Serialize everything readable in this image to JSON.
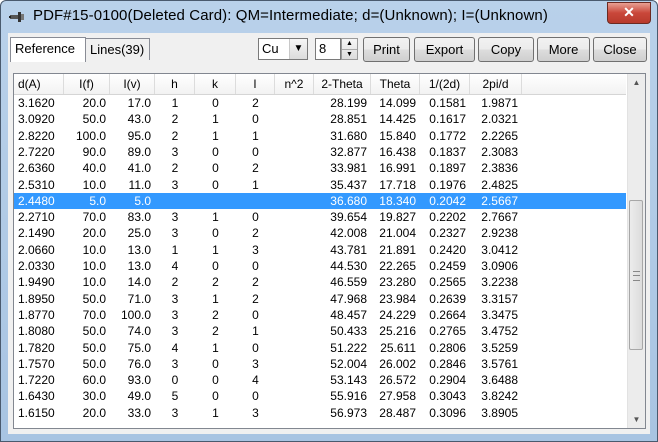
{
  "window": {
    "title": "PDF#15-0100(Deleted Card): QM=Intermediate; d=(Unknown); I=(Unknown)",
    "close_label": "✕"
  },
  "tabs": [
    {
      "label": "Reference"
    },
    {
      "label": "Lines(39)"
    }
  ],
  "controls": {
    "wavelength": "Cu",
    "decimals": "8",
    "print_label": "Print",
    "export_label": "Export",
    "copy_label": "Copy",
    "more_label": "More",
    "close_label": "Close"
  },
  "table": {
    "columns": [
      "d(A)",
      "I(f)",
      "I(v)",
      "h",
      "k",
      "l",
      "n^2",
      "2-Theta",
      "Theta",
      "1/(2d)",
      "2pi/d"
    ],
    "rows": [
      [
        "3.1620",
        "20.0",
        "17.0",
        "1",
        "0",
        "2",
        "",
        "28.199",
        "14.099",
        "0.1581",
        "1.9871"
      ],
      [
        "3.0920",
        "50.0",
        "43.0",
        "2",
        "1",
        "0",
        "",
        "28.851",
        "14.425",
        "0.1617",
        "2.0321"
      ],
      [
        "2.8220",
        "100.0",
        "95.0",
        "2",
        "1",
        "1",
        "",
        "31.680",
        "15.840",
        "0.1772",
        "2.2265"
      ],
      [
        "2.7220",
        "90.0",
        "89.0",
        "3",
        "0",
        "0",
        "",
        "32.877",
        "16.438",
        "0.1837",
        "2.3083"
      ],
      [
        "2.6360",
        "40.0",
        "41.0",
        "2",
        "0",
        "2",
        "",
        "33.981",
        "16.991",
        "0.1897",
        "2.3836"
      ],
      [
        "2.5310",
        "10.0",
        "11.0",
        "3",
        "0",
        "1",
        "",
        "35.437",
        "17.718",
        "0.1976",
        "2.4825"
      ],
      [
        "2.4480",
        "5.0",
        "5.0",
        "",
        "",
        "",
        "",
        "36.680",
        "18.340",
        "0.2042",
        "2.5667"
      ],
      [
        "2.2710",
        "70.0",
        "83.0",
        "3",
        "1",
        "0",
        "",
        "39.654",
        "19.827",
        "0.2202",
        "2.7667"
      ],
      [
        "2.1490",
        "20.0",
        "25.0",
        "3",
        "0",
        "2",
        "",
        "42.008",
        "21.004",
        "0.2327",
        "2.9238"
      ],
      [
        "2.0660",
        "10.0",
        "13.0",
        "1",
        "1",
        "3",
        "",
        "43.781",
        "21.891",
        "0.2420",
        "3.0412"
      ],
      [
        "2.0330",
        "10.0",
        "13.0",
        "4",
        "0",
        "0",
        "",
        "44.530",
        "22.265",
        "0.2459",
        "3.0906"
      ],
      [
        "1.9490",
        "10.0",
        "14.0",
        "2",
        "2",
        "2",
        "",
        "46.559",
        "23.280",
        "0.2565",
        "3.2238"
      ],
      [
        "1.8950",
        "50.0",
        "71.0",
        "3",
        "1",
        "2",
        "",
        "47.968",
        "23.984",
        "0.2639",
        "3.3157"
      ],
      [
        "1.8770",
        "70.0",
        "100.0",
        "3",
        "2",
        "0",
        "",
        "48.457",
        "24.229",
        "0.2664",
        "3.3475"
      ],
      [
        "1.8080",
        "50.0",
        "74.0",
        "3",
        "2",
        "1",
        "",
        "50.433",
        "25.216",
        "0.2765",
        "3.4752"
      ],
      [
        "1.7820",
        "50.0",
        "75.0",
        "4",
        "1",
        "0",
        "",
        "51.222",
        "25.611",
        "0.2806",
        "3.5259"
      ],
      [
        "1.7570",
        "50.0",
        "76.0",
        "3",
        "0",
        "3",
        "",
        "52.004",
        "26.002",
        "0.2846",
        "3.5761"
      ],
      [
        "1.7220",
        "60.0",
        "93.0",
        "0",
        "0",
        "4",
        "",
        "53.143",
        "26.572",
        "0.2904",
        "3.6488"
      ],
      [
        "1.6430",
        "30.0",
        "49.0",
        "5",
        "0",
        "0",
        "",
        "55.916",
        "27.958",
        "0.3043",
        "3.8242"
      ],
      [
        "1.6150",
        "20.0",
        "33.0",
        "3",
        "1",
        "3",
        "",
        "56.973",
        "28.487",
        "0.3096",
        "3.8905"
      ]
    ],
    "selected_row": 6
  },
  "colors": {
    "selection": "#3399ff",
    "titlebar": "#b9d1ea"
  }
}
